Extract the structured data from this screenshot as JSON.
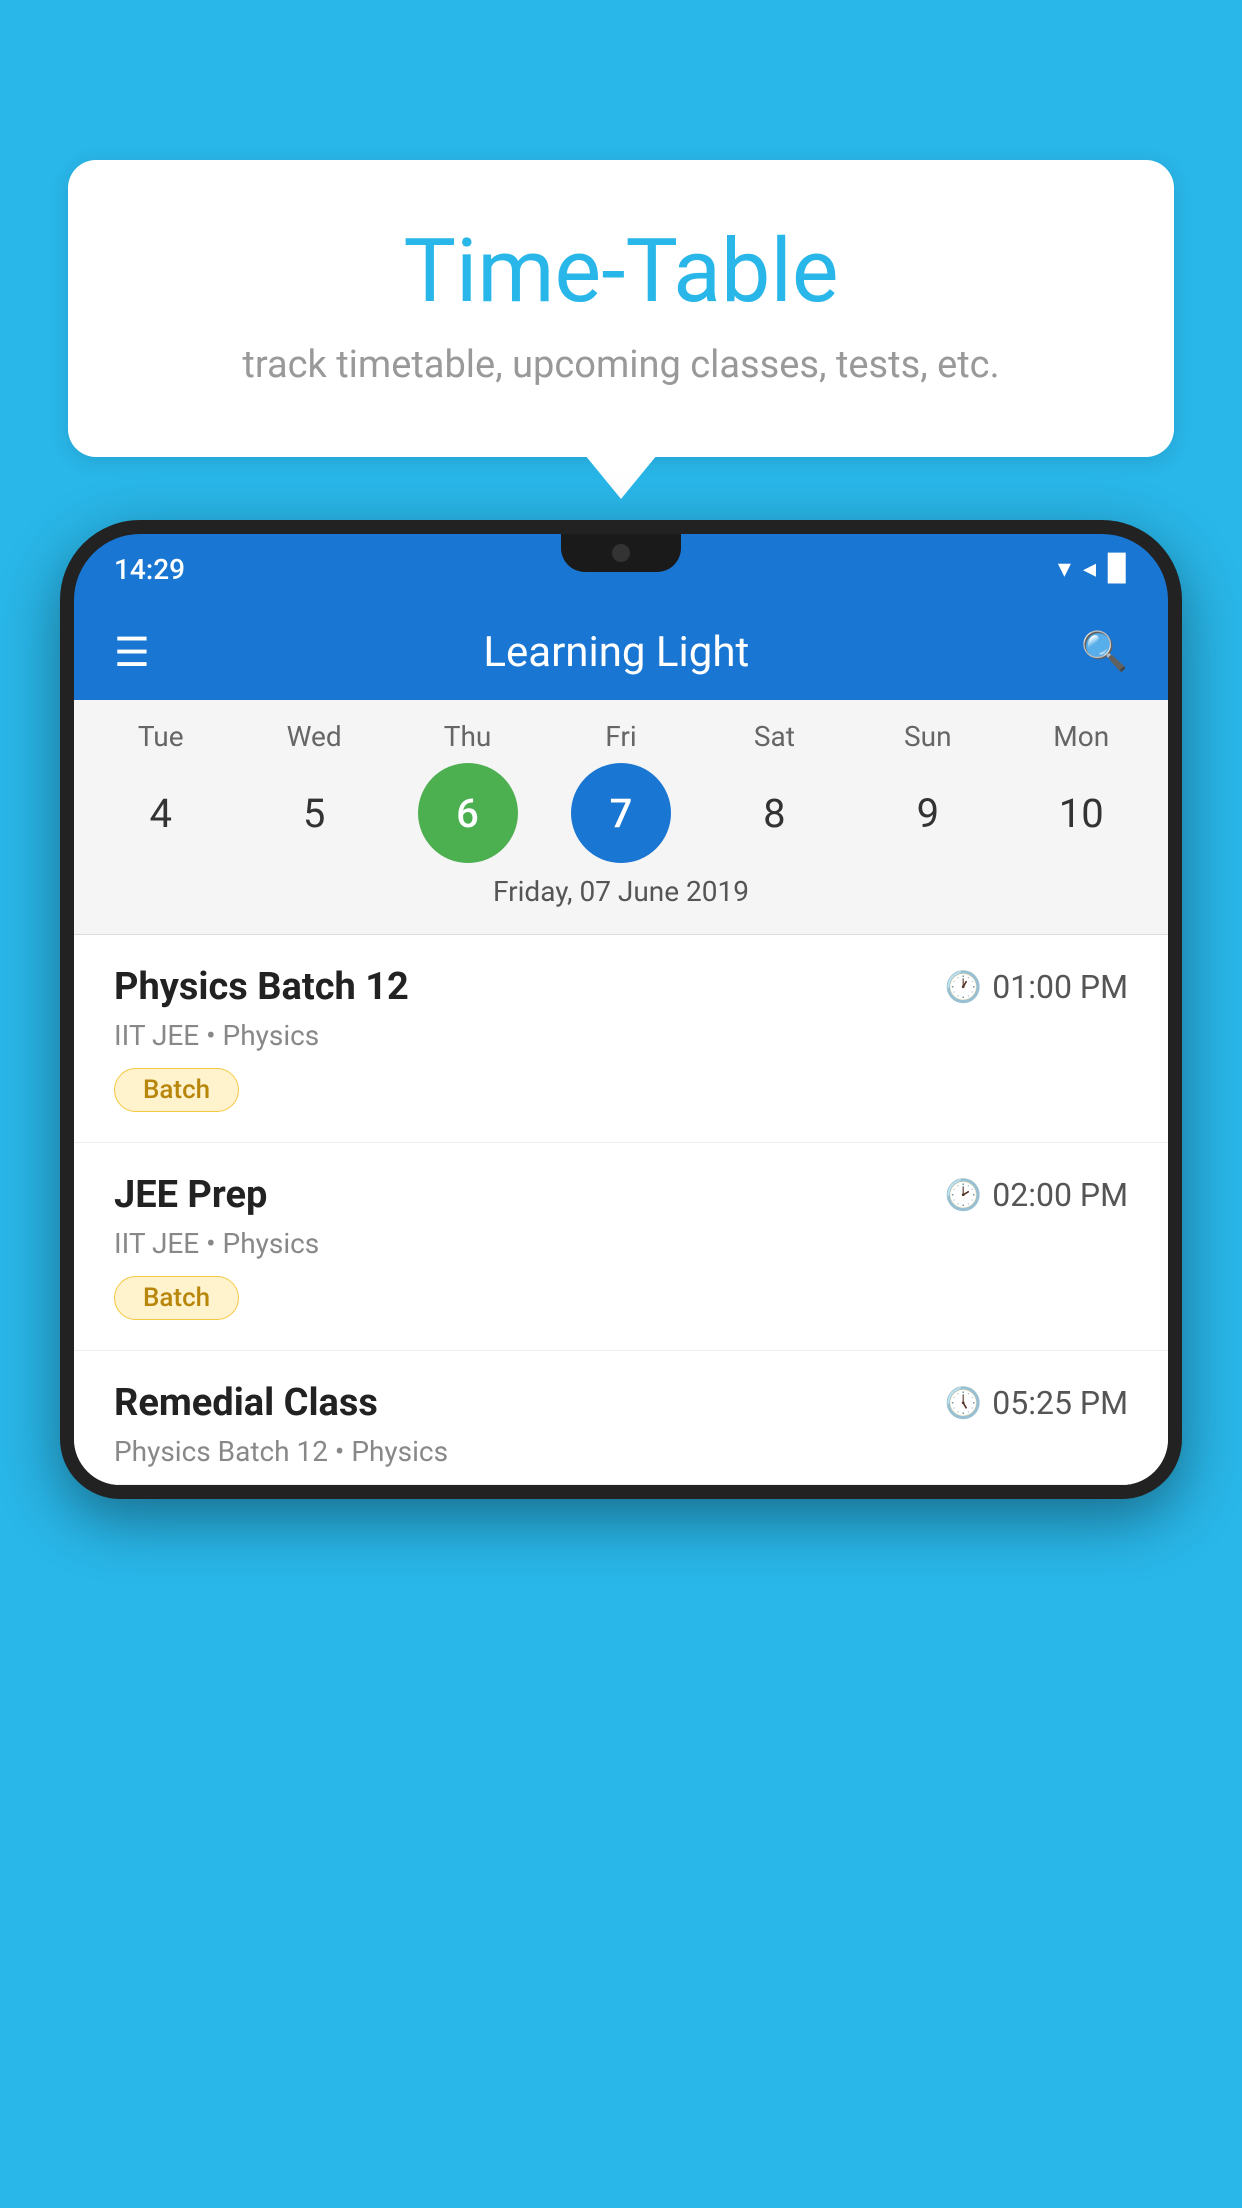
{
  "background_color": "#29B6E8",
  "speech_bubble": {
    "title": "Time-Table",
    "subtitle": "track timetable, upcoming classes, tests, etc."
  },
  "phone": {
    "status_bar": {
      "time": "14:29",
      "wifi": "▾",
      "signal": "▲",
      "battery": "▉"
    },
    "app_bar": {
      "title": "Learning Light",
      "hamburger_label": "≡",
      "search_label": "🔍"
    },
    "calendar": {
      "days": [
        {
          "label": "Tue",
          "num": "4",
          "state": "normal"
        },
        {
          "label": "Wed",
          "num": "5",
          "state": "normal"
        },
        {
          "label": "Thu",
          "num": "6",
          "state": "today"
        },
        {
          "label": "Fri",
          "num": "7",
          "state": "selected"
        },
        {
          "label": "Sat",
          "num": "8",
          "state": "normal"
        },
        {
          "label": "Sun",
          "num": "9",
          "state": "normal"
        },
        {
          "label": "Mon",
          "num": "10",
          "state": "normal"
        }
      ],
      "selected_date_label": "Friday, 07 June 2019"
    },
    "schedule": [
      {
        "name": "Physics Batch 12",
        "time": "01:00 PM",
        "detail": "IIT JEE • Physics",
        "badge": "Batch"
      },
      {
        "name": "JEE Prep",
        "time": "02:00 PM",
        "detail": "IIT JEE • Physics",
        "badge": "Batch"
      },
      {
        "name": "Remedial Class",
        "time": "05:25 PM",
        "detail": "Physics Batch 12 • Physics",
        "badge": null
      }
    ]
  }
}
